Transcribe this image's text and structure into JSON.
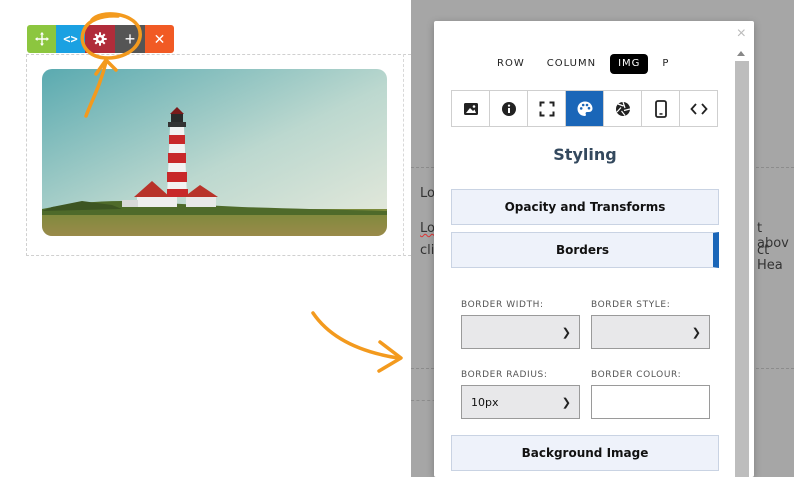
{
  "toolbar": {
    "move_icon": "move-arrows-icon",
    "code_glyph": "<>",
    "gear_icon": "gear-icon",
    "add_glyph": "+",
    "delete_glyph": "✕"
  },
  "background_text": {
    "line1": "Lo",
    "line2_start": "Lo",
    "line2_end": "t abov",
    "line3_start": "cli",
    "line3_end": "ct Hea"
  },
  "modal": {
    "close_glyph": "×",
    "tag_tabs": [
      {
        "label": "ROW"
      },
      {
        "label": "COLUMN"
      },
      {
        "label": "IMG",
        "active": true
      },
      {
        "label": "P"
      }
    ],
    "icon_tabs": [
      {
        "icon": "image-icon"
      },
      {
        "icon": "info-icon"
      },
      {
        "icon": "fullscreen-icon"
      },
      {
        "icon": "palette-icon",
        "active": true
      },
      {
        "icon": "aperture-icon"
      },
      {
        "icon": "mobile-icon"
      },
      {
        "icon": "code-icon"
      }
    ],
    "section_title": "Styling",
    "accordions": {
      "opacity": "Opacity and Transforms",
      "borders": "Borders",
      "background": "Background Image"
    },
    "fields": {
      "border_width_label": "BORDER WIDTH:",
      "border_style_label": "BORDER STYLE:",
      "border_radius_label": "BORDER RADIUS:",
      "border_colour_label": "BORDER COLOUR:",
      "border_width_value": "",
      "border_style_value": "",
      "border_radius_value": "10px",
      "border_colour_value": ""
    }
  },
  "colors": {
    "accent_blue": "#1a66b8",
    "move_green": "#8cc63f",
    "code_blue": "#1ba1e2",
    "gear_red": "#b02c3a",
    "add_grey": "#555555",
    "delete_orange": "#f15a24",
    "annotation_orange": "#f39a1e",
    "overlay_grey": "#a6a6a6"
  }
}
